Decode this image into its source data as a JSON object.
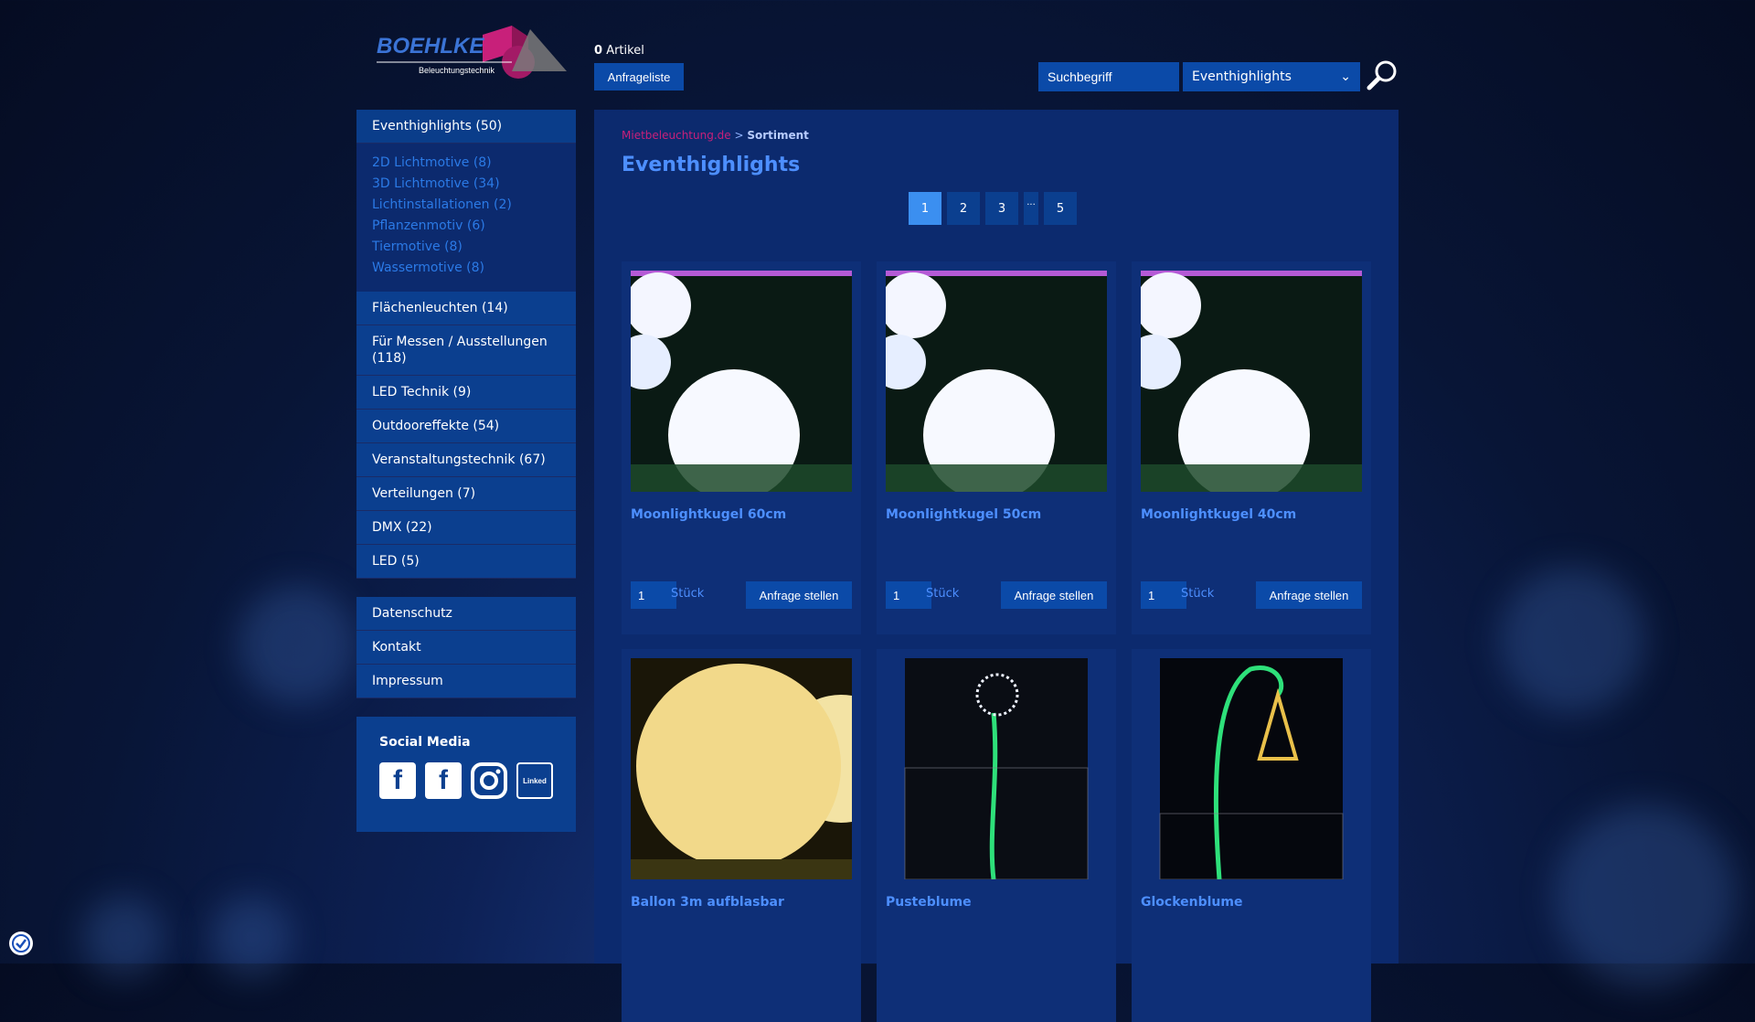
{
  "header": {
    "logo_text": "BOEHLKE",
    "logo_subtitle": "Beleuchtungstechnik",
    "cart_count": "0",
    "cart_label": "Artikel",
    "inquiry_list_button": "Anfrageliste",
    "search_placeholder": "Suchbegriff",
    "search_category": "Eventhighlights"
  },
  "sidebar": {
    "active": "Eventhighlights (50)",
    "subitems": [
      "2D Lichtmotive (8)",
      "3D Lichtmotive (34)",
      "Lichtinstallationen (2)",
      "Pflanzenmotiv (6)",
      "Tiermotive (8)",
      "Wassermotive (8)"
    ],
    "categories": [
      "Flächenleuchten (14)",
      "Für Messen / Ausstellungen (118)",
      "LED Technik (9)",
      "Outdooreffekte (54)",
      "Veranstaltungstechnik (67)",
      "Verteilungen (7)",
      "DMX (22)",
      "LED (5)"
    ],
    "links": [
      "Datenschutz",
      "Kontakt",
      "Impressum"
    ],
    "social_title": "Social Media",
    "social_icons": [
      "facebook-icon",
      "facebook-icon",
      "instagram-icon",
      "linkedin-icon"
    ],
    "linkedin_text": "Linked"
  },
  "main": {
    "breadcrumb_link": "Mietbeleuchtung.de",
    "breadcrumb_sep": " > ",
    "breadcrumb_current": "Sortiment",
    "title": "Eventhighlights",
    "pages": [
      "1",
      "2",
      "3",
      "...",
      "5"
    ],
    "active_page": "1",
    "products": [
      {
        "name": "Moonlightkugel 60cm",
        "qty": "1",
        "unit": "Stück",
        "button": "Anfrage stellen"
      },
      {
        "name": "Moonlightkugel 50cm",
        "qty": "1",
        "unit": "Stück",
        "button": "Anfrage stellen"
      },
      {
        "name": "Moonlightkugel 40cm",
        "qty": "1",
        "unit": "Stück",
        "button": "Anfrage stellen"
      },
      {
        "name": "Ballon 3m aufblasbar"
      },
      {
        "name": "Pusteblume"
      },
      {
        "name": "Glockenblume"
      }
    ]
  },
  "colors": {
    "accent": "#0b4aa8",
    "link_blue": "#4d8fff",
    "brand_pink": "#c8207a",
    "panel": "#0c2a6e"
  }
}
